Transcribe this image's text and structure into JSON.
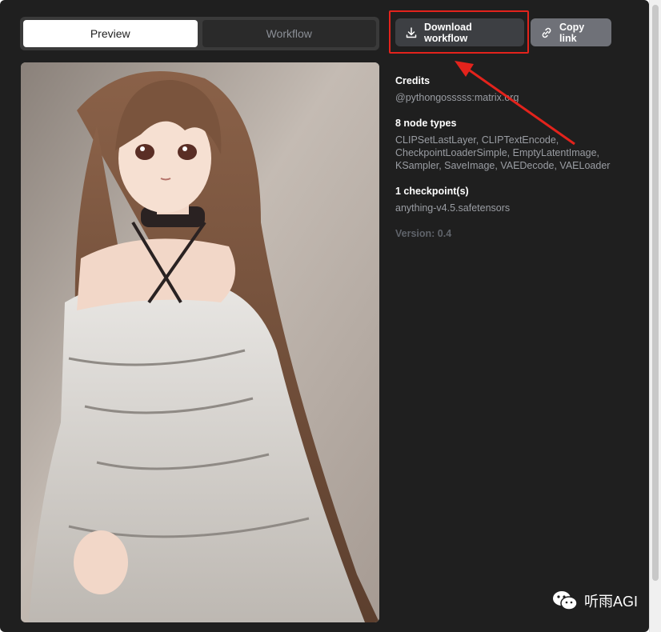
{
  "tabs": [
    {
      "label": "Preview",
      "active": true
    },
    {
      "label": "Workflow",
      "active": false
    }
  ],
  "actions": {
    "download_label": "Download workflow",
    "copy_label": "Copy link"
  },
  "info": {
    "credits_title": "Credits",
    "credits_value": "@pythongosssss:matrix.org",
    "node_types_title": "8 node types",
    "node_types_value": "CLIPSetLastLayer, CLIPTextEncode, CheckpointLoaderSimple, EmptyLatentImage, KSampler, SaveImage, VAEDecode, VAELoader",
    "checkpoints_title": "1 checkpoint(s)",
    "checkpoints_value": "anything-v4.5.safetensors",
    "version": "Version: 0.4"
  },
  "watermark": {
    "text": "听雨AGI"
  },
  "colors": {
    "highlight": "#e3231c",
    "panel_bg": "#1f1f1f"
  }
}
